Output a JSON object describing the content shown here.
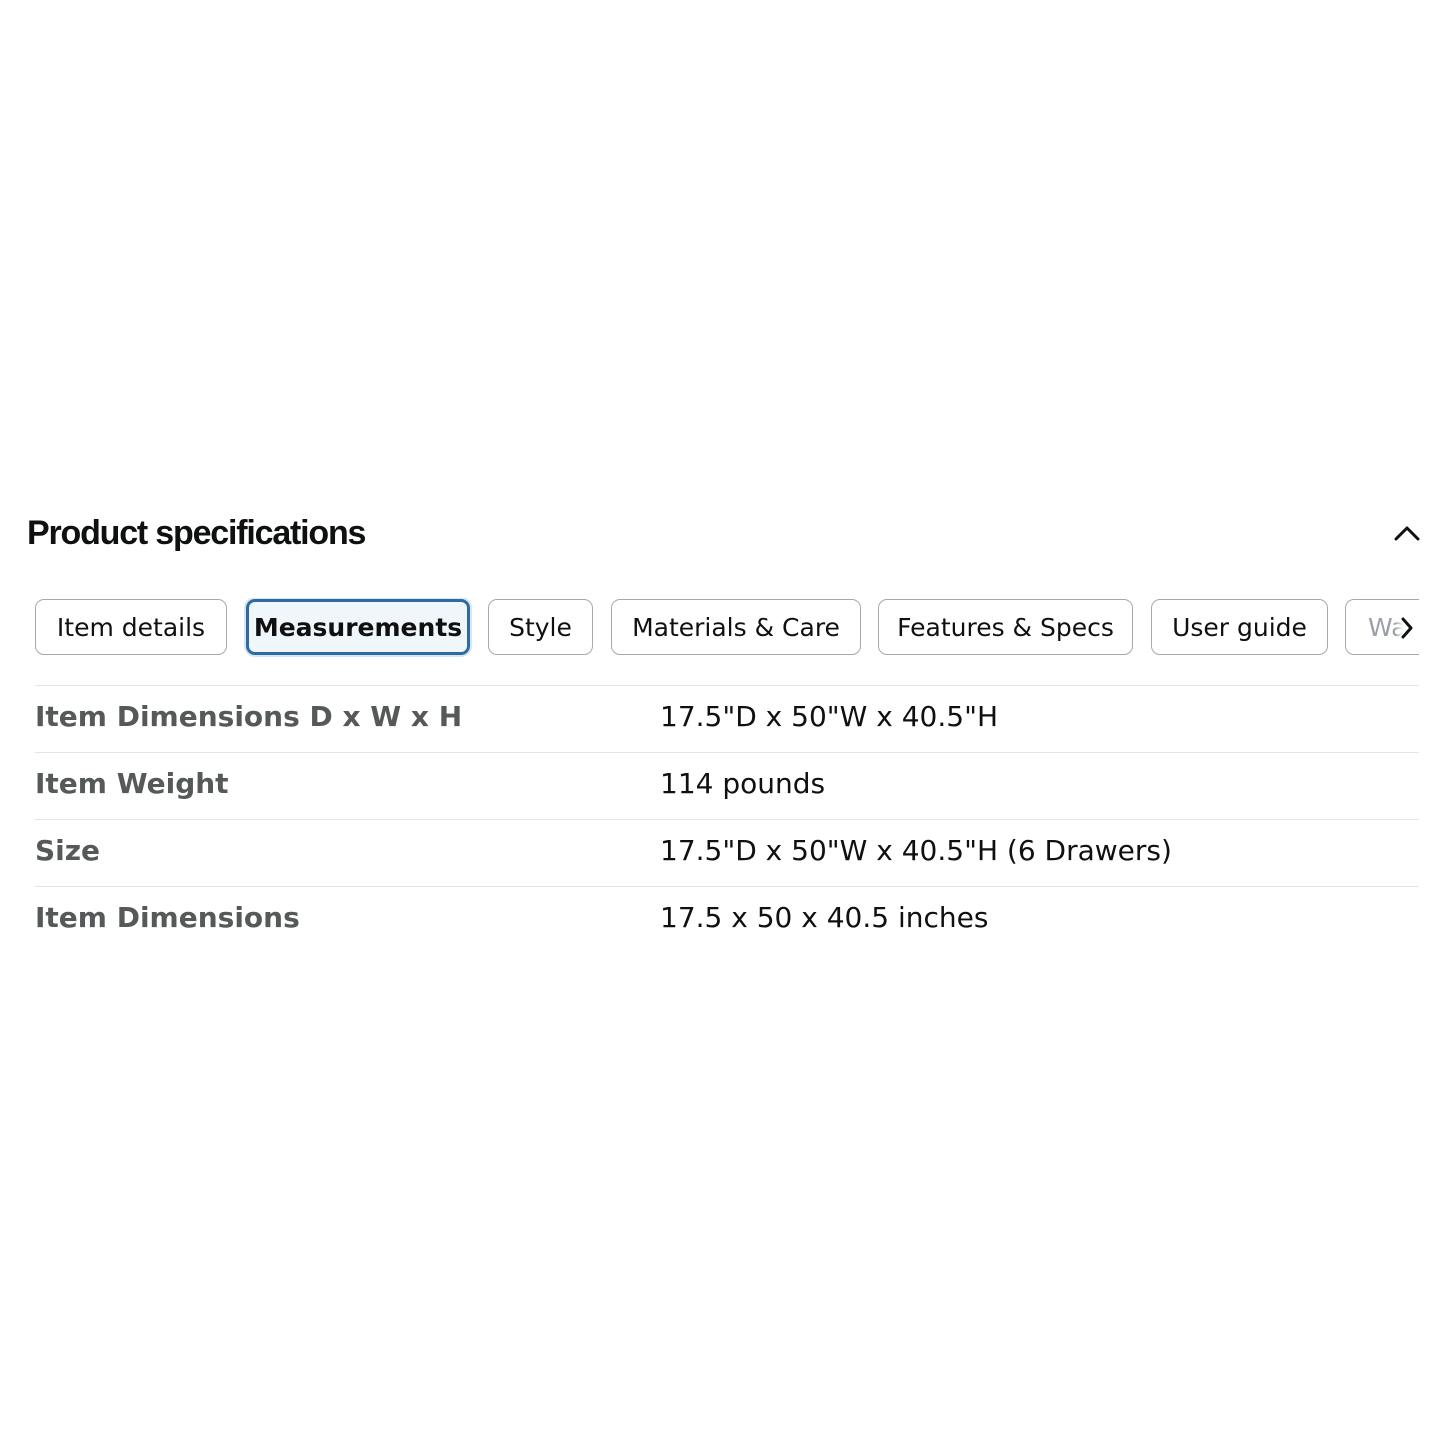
{
  "section": {
    "title": "Product specifications",
    "collapse_icon": "chevron-up-icon"
  },
  "tabs": [
    {
      "label": "Item details",
      "active": false
    },
    {
      "label": "Measurements",
      "active": true
    },
    {
      "label": "Style",
      "active": false
    },
    {
      "label": "Materials & Care",
      "active": false
    },
    {
      "label": "Features & Specs",
      "active": false
    },
    {
      "label": "User guide",
      "active": false
    },
    {
      "label": "Wa",
      "active": false
    }
  ],
  "scroll_icon": "chevron-right-icon",
  "specs": [
    {
      "label": "Item Dimensions D x W x H",
      "value": "17.5\"D x 50\"W x 40.5\"H"
    },
    {
      "label": "Item Weight",
      "value": "114 pounds"
    },
    {
      "label": "Size",
      "value": "17.5\"D x 50\"W x 40.5\"H (6 Drawers)"
    },
    {
      "label": "Item Dimensions",
      "value": "17.5 x 50 x 40.5 inches"
    }
  ],
  "colors": {
    "active_tab_border": "#2f6ba0",
    "active_tab_bg": "#f0f7fc",
    "label_text": "#565959",
    "divider": "#e3e6e6"
  }
}
